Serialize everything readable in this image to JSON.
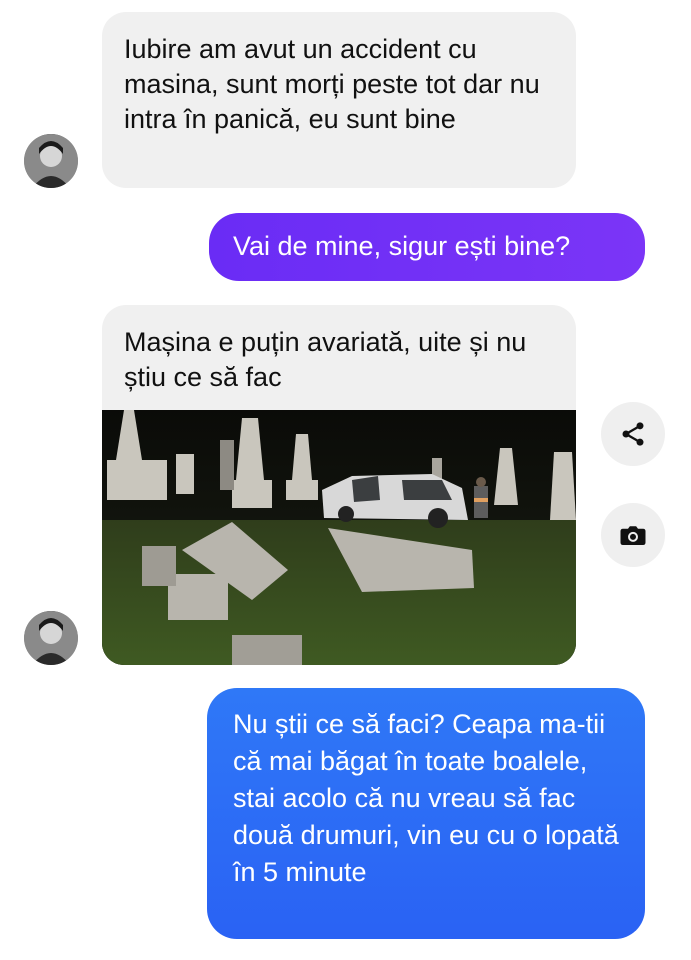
{
  "chat": {
    "messages": [
      {
        "from": "them",
        "text": "Iubire am avut un accident cu masina, sunt morți peste tot dar nu intra în panică, eu sunt bine"
      },
      {
        "from": "me",
        "text": "Vai de mine, sigur ești bine?"
      },
      {
        "from": "them",
        "text": "Mașina e puțin avariată, uite și nu știu ce să fac",
        "attachment": "photo"
      },
      {
        "from": "me",
        "text": "Nu știi ce să faci? Ceapa ma-tii că mai băgat în toate boalele, stai acolo că nu vreau să fac două drumuri, vin eu cu o lopată în 5 minute"
      }
    ]
  },
  "actions": {
    "share_icon": "share-icon",
    "camera_icon": "camera-icon"
  },
  "colors": {
    "incoming_bg": "#f0f0f0",
    "outgoing_purple": "#6a2cf5",
    "outgoing_blue": "#2a6cf5",
    "action_bg": "#efefef"
  }
}
